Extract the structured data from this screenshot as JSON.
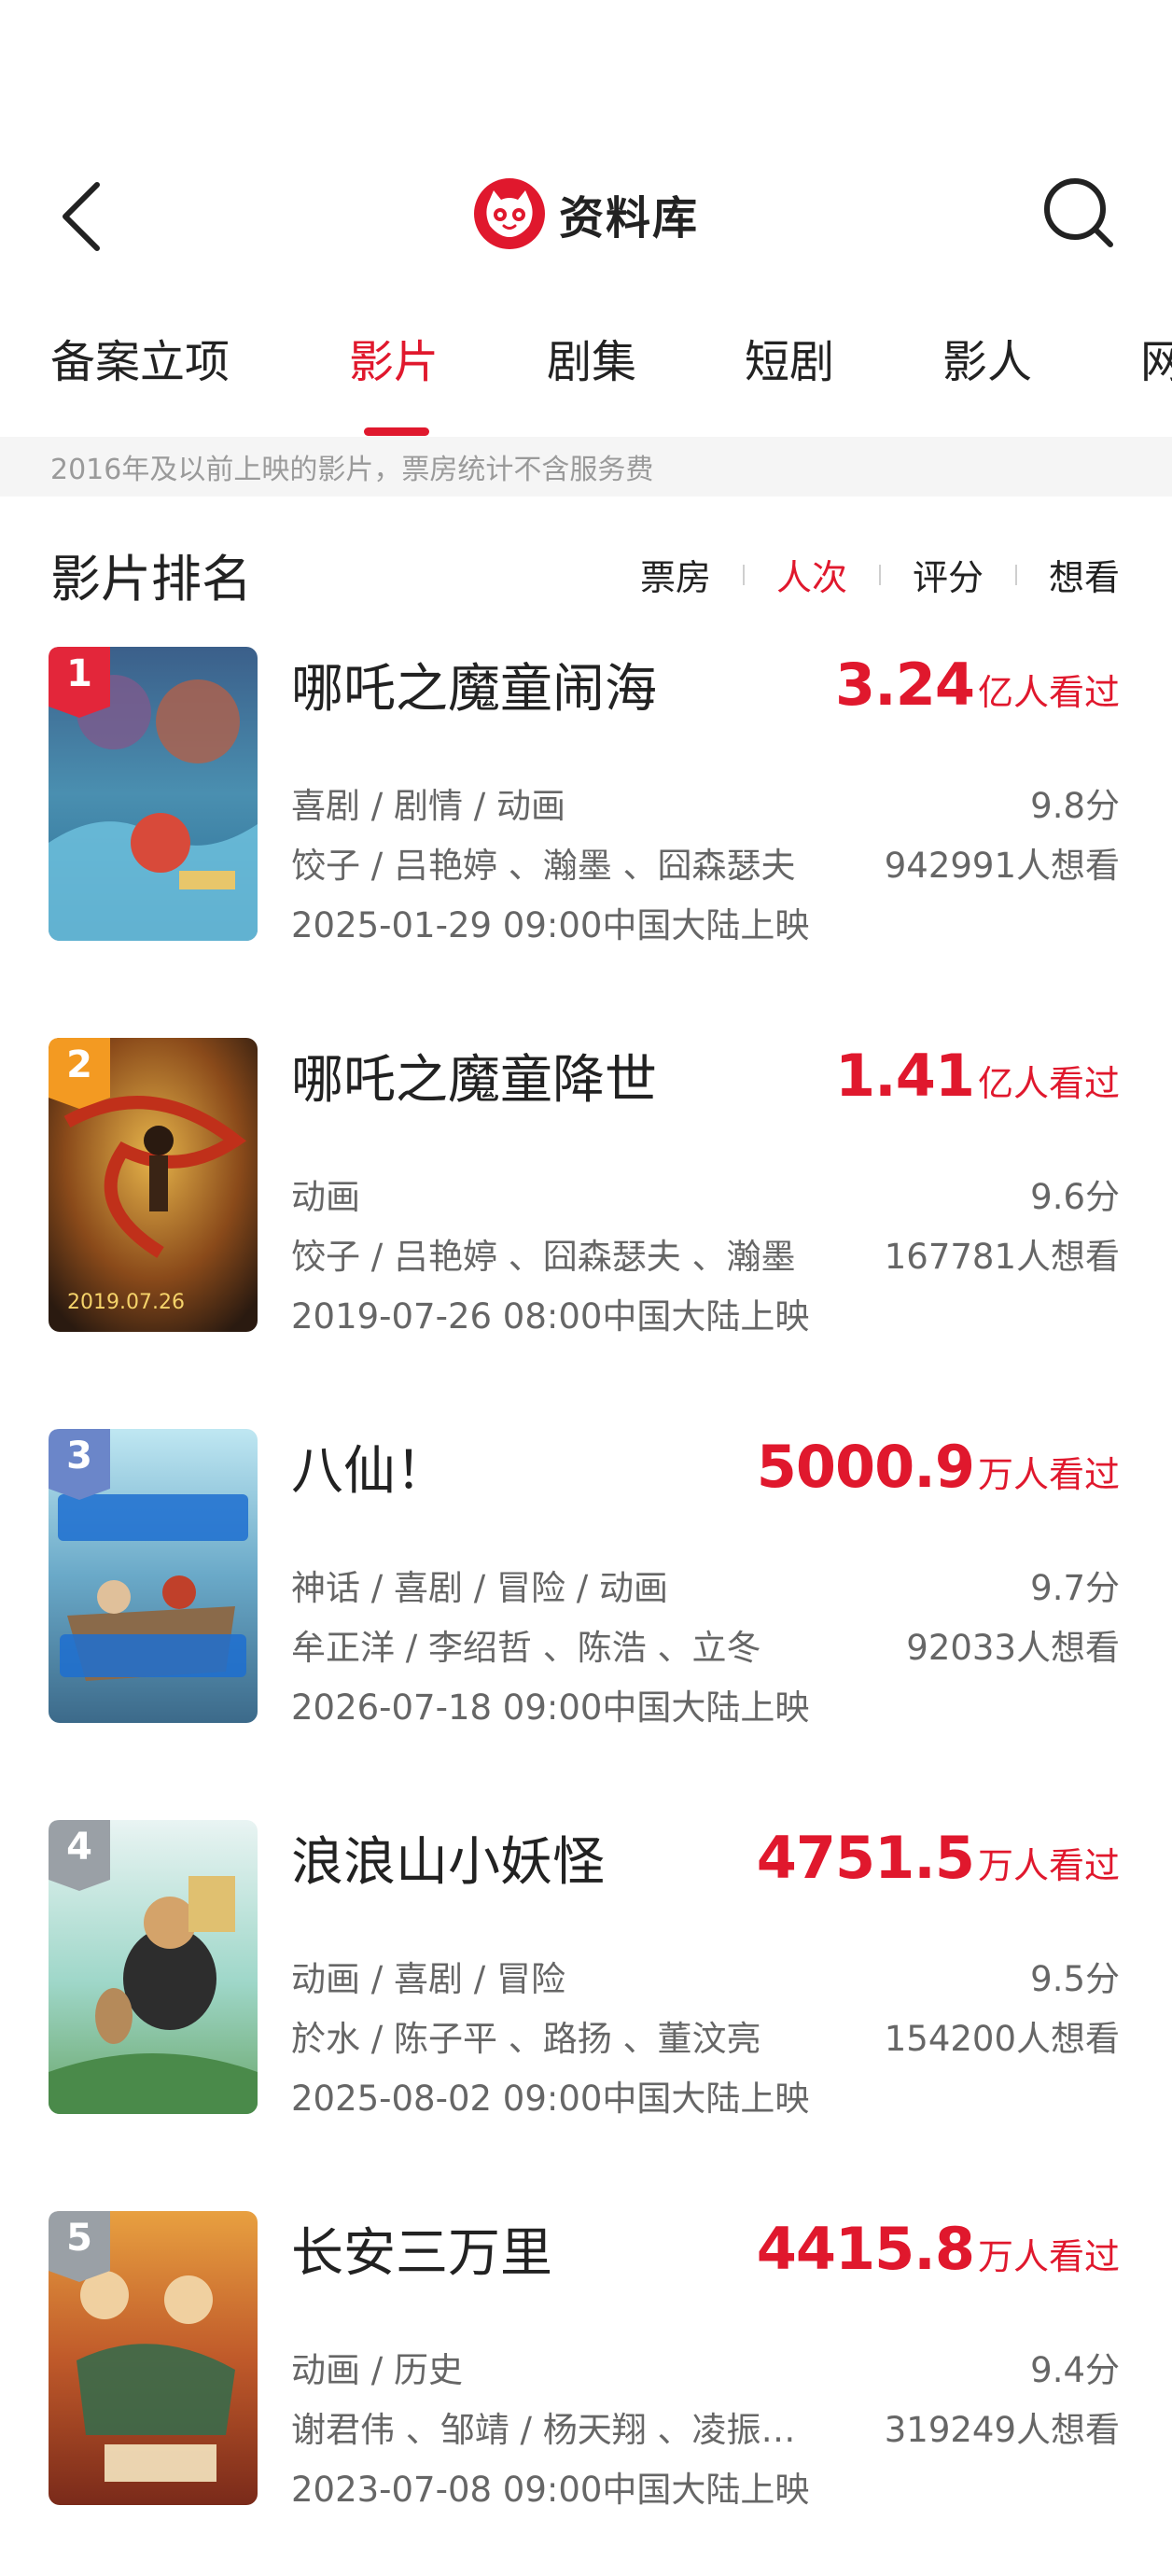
{
  "header": {
    "title": "资料库"
  },
  "tabs": [
    {
      "label": "备案立项",
      "active": false
    },
    {
      "label": "影片",
      "active": true
    },
    {
      "label": "剧集",
      "active": false
    },
    {
      "label": "短剧",
      "active": false
    },
    {
      "label": "影人",
      "active": false
    },
    {
      "label": "网",
      "active": false
    }
  ],
  "notice": "2016年及以前上映的影片，票房统计不含服务费",
  "ranking": {
    "title": "影片排名",
    "sort_options": [
      {
        "label": "票房",
        "active": false
      },
      {
        "label": "人次",
        "active": true
      },
      {
        "label": "评分",
        "active": false
      },
      {
        "label": "想看",
        "active": false
      }
    ]
  },
  "movies": [
    {
      "rank": "1",
      "title": "哪吒之魔童闹海",
      "box_value": "3.24",
      "box_unit": "亿人看过",
      "genres": "喜剧 / 剧情 / 动画",
      "score": "9.8分",
      "cast": "饺子 / 吕艳婷 、瀚墨 、囧森瑟夫",
      "wish": "942991人想看",
      "release": "2025-01-29 09:00中国大陆上映"
    },
    {
      "rank": "2",
      "title": "哪吒之魔童降世",
      "box_value": "1.41",
      "box_unit": "亿人看过",
      "genres": "动画",
      "score": "9.6分",
      "cast": "饺子 / 吕艳婷 、囧森瑟夫 、瀚墨",
      "wish": "167781人想看",
      "release": "2019-07-26 08:00中国大陆上映"
    },
    {
      "rank": "3",
      "title": "八仙！",
      "box_value": "5000.9",
      "box_unit": "万人看过",
      "genres": "神话 / 喜剧 / 冒险 / 动画",
      "score": "9.7分",
      "cast": "牟正洋 / 李绍哲 、陈浩 、立冬",
      "wish": "92033人想看",
      "release": "2026-07-18 09:00中国大陆上映"
    },
    {
      "rank": "4",
      "title": "浪浪山小妖怪",
      "box_value": "4751.5",
      "box_unit": "万人看过",
      "genres": "动画 / 喜剧 / 冒险",
      "score": "9.5分",
      "cast": "於水 / 陈子平 、路扬 、董汶亮",
      "wish": "154200人想看",
      "release": "2025-08-02 09:00中国大陆上映"
    },
    {
      "rank": "5",
      "title": "长安三万里",
      "box_value": "4415.8",
      "box_unit": "万人看过",
      "genres": "动画 / 历史",
      "score": "9.4分",
      "cast": "谢君伟 、邹靖 / 杨天翔 、凌振…",
      "wish": "319249人想看",
      "release": "2023-07-08 09:00中国大陆上映"
    }
  ],
  "colors": {
    "accent": "#e0182d",
    "rank1": "#e3263a",
    "rank2": "#f39a22",
    "rank3": "#6b86c9",
    "rank_other": "#9aa0a6"
  }
}
